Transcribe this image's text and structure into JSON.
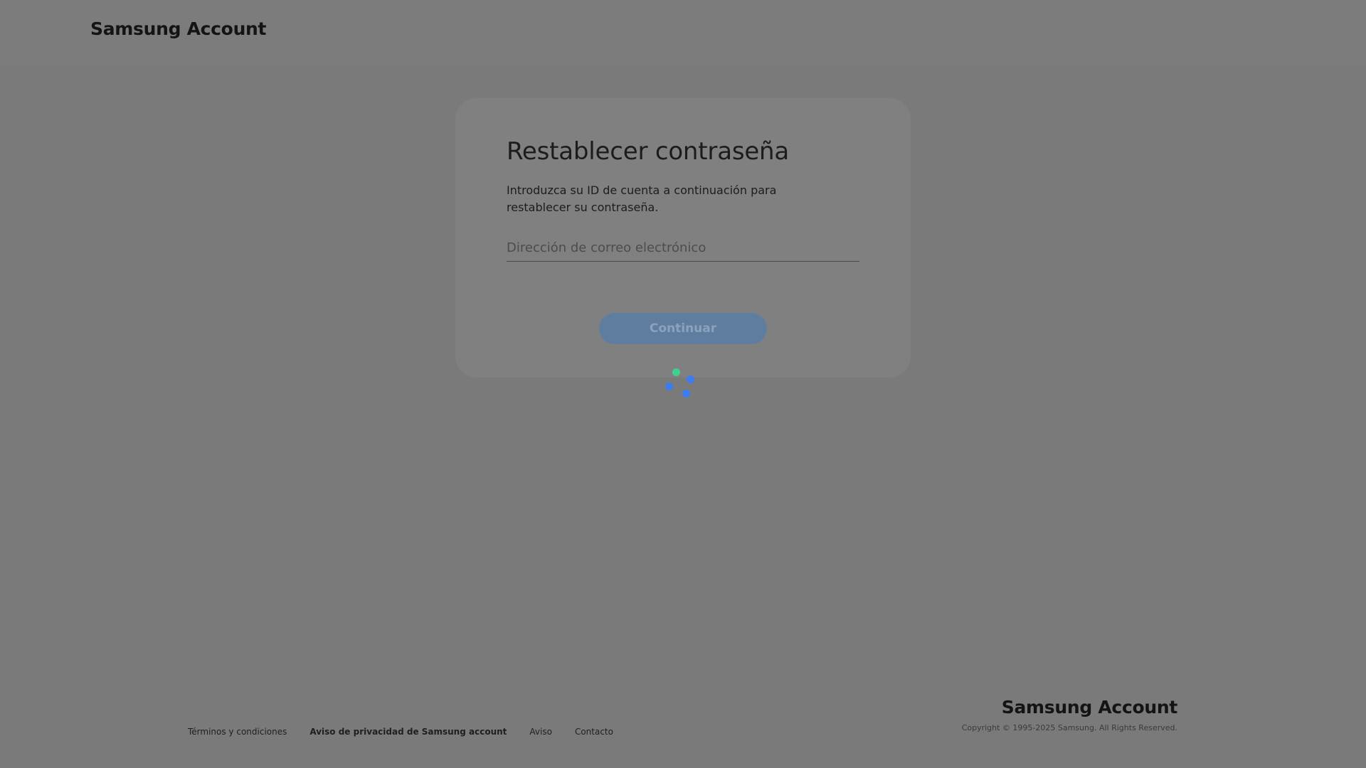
{
  "header": {
    "logo": "Samsung Account"
  },
  "card": {
    "title": "Restablecer contraseña",
    "description": "Introduzca su ID de cuenta a continuación para restablecer su contraseña.",
    "email_placeholder": "Dirección de correo electrónico",
    "email_value": "",
    "continue_label": "Continuar"
  },
  "footer": {
    "links": [
      "Términos y condiciones",
      "Aviso de privacidad de Samsung account",
      "Aviso",
      "Contacto"
    ],
    "logo": "Samsung Account",
    "copyright": "Copyright © 1995-2025 Samsung. All Rights Reserved."
  },
  "colors": {
    "overlay": "#7a7a7a",
    "button": "#5f7d9e",
    "spinner_blue": "#3b7cf0",
    "spinner_green": "#3fcf8e"
  },
  "icons": {
    "loading": "loading-spinner-icon"
  }
}
